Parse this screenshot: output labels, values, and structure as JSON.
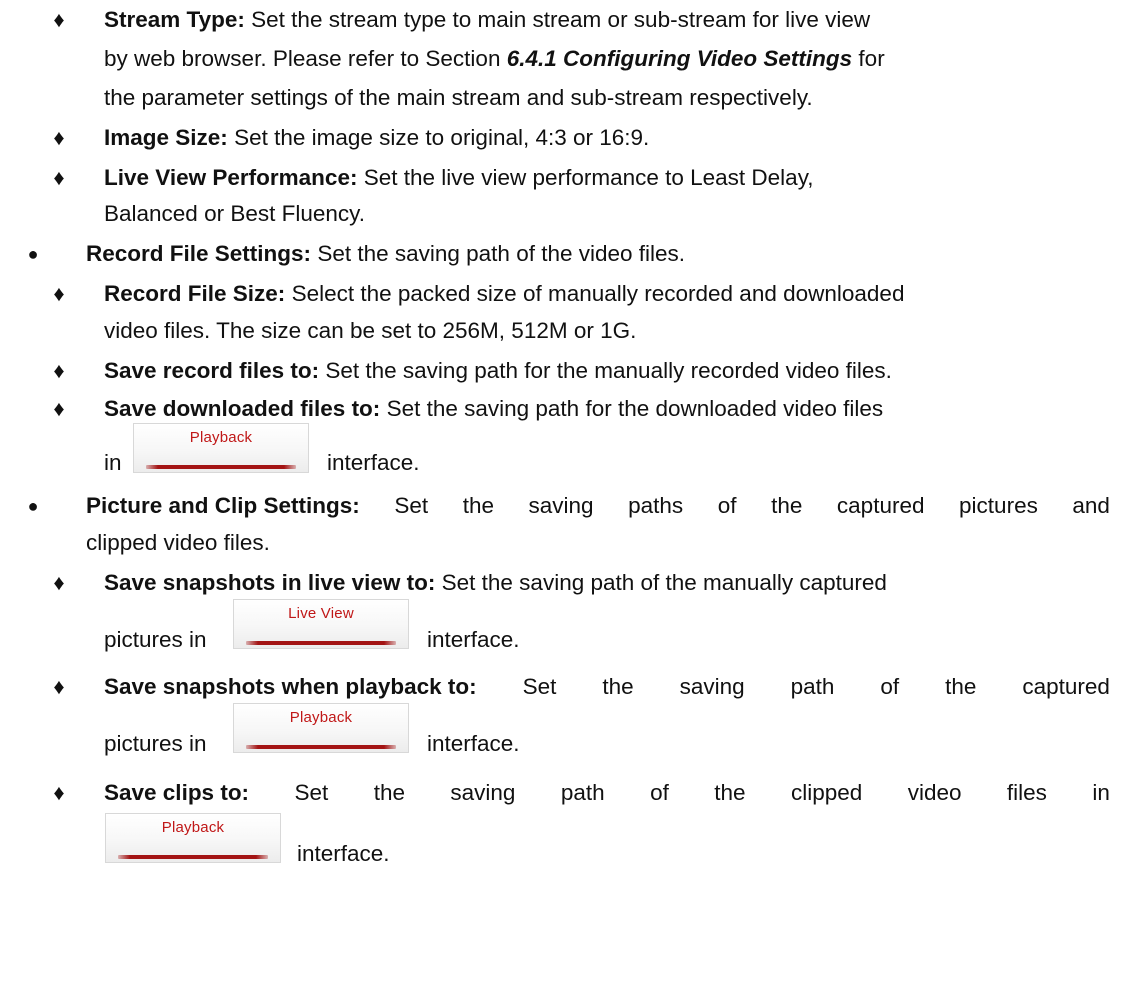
{
  "colors": {
    "text": "#111111",
    "button_text": "#c01818",
    "button_underline": "#a31414"
  },
  "icons": {
    "circle_bullet": "●",
    "diamond_bullet": "♦"
  },
  "stream_type": {
    "label": "Stream Type:",
    "line1": "Set the stream type to main stream or sub-stream for live view",
    "line2_pre": "by web browser. Please refer to Section ",
    "line2_ref": "6.4.1 Configuring Video Settings",
    "line2_post": " for",
    "line3": "the parameter settings of the main stream and sub-stream respectively."
  },
  "image_size": {
    "label": "Image Size:",
    "text": "Set the image size to original, 4:3 or 16:9."
  },
  "live_view_performance": {
    "label": "Live View Performance:",
    "line1": "Set the live view performance to Least Delay,",
    "line2": "Balanced or Best Fluency."
  },
  "record_file_settings": {
    "label": "Record File Settings:",
    "text": "Set the saving path of the video files."
  },
  "record_file_size": {
    "label": "Record File Size:",
    "line1": "Select the packed size of manually recorded and downloaded",
    "line2": "video files. The size can be set to 256M, 512M or 1G."
  },
  "save_record_files": {
    "label": "Save record files to:",
    "text": "Set the saving path for the manually recorded video files."
  },
  "save_downloaded_files": {
    "label": "Save downloaded files to:",
    "line1": "Set the saving path for the downloaded video files",
    "line2_pre": "in",
    "button": "Playback",
    "line2_post": "interface."
  },
  "picture_clip_settings": {
    "label": "Picture and Clip Settings:",
    "line1_words": [
      "Set",
      "the",
      "saving",
      "paths",
      "of",
      "the",
      "captured",
      "pictures",
      "and"
    ],
    "line2": "clipped video files."
  },
  "save_snapshots_live": {
    "label": "Save snapshots in live view to:",
    "line1": "Set the saving path of the manually captured",
    "line2_pre": "pictures in",
    "button": "Live View",
    "line2_post": "interface."
  },
  "save_snapshots_playback": {
    "label": "Save snapshots when playback to:",
    "line1_words": [
      "Set",
      "the",
      "saving",
      "path",
      "of",
      "the",
      "captured"
    ],
    "line2_pre": "pictures in",
    "button": "Playback",
    "line2_post": "interface."
  },
  "save_clips": {
    "label": "Save clips to:",
    "line1_words": [
      "Set",
      "the",
      "saving",
      "path",
      "of",
      "the",
      "clipped",
      "video",
      "files",
      "in"
    ],
    "button": "Playback",
    "line2_post": "interface."
  }
}
